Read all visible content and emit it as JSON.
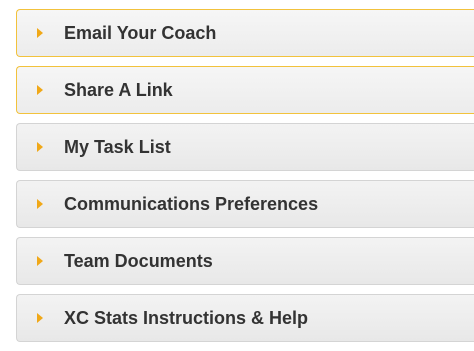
{
  "accordion": {
    "items": [
      {
        "label": "Email Your Coach",
        "icon": "caret-right-icon"
      },
      {
        "label": "Share A Link",
        "icon": "caret-right-icon"
      },
      {
        "label": "My Task List",
        "icon": "caret-right-icon"
      },
      {
        "label": "Communications Preferences",
        "icon": "caret-right-icon"
      },
      {
        "label": "Team Documents",
        "icon": "caret-right-icon"
      },
      {
        "label": "XC Stats Instructions & Help",
        "icon": "caret-right-icon"
      }
    ]
  },
  "colors": {
    "arrow": "#f0a818",
    "highlight_border": "#f2c23c",
    "panel_bg": "#ececec",
    "text": "#333333"
  }
}
